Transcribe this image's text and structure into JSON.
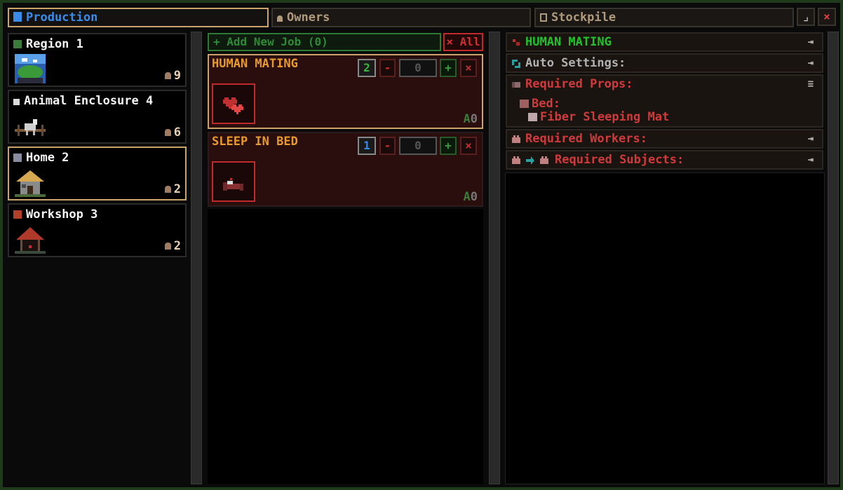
{
  "tabs": {
    "production": "Production",
    "owners": "Owners",
    "stockpile": "Stockpile"
  },
  "window": {
    "minimize_icon": "⌟",
    "close_icon": "×"
  },
  "buildings": [
    {
      "name": "Region 1",
      "count": "9",
      "icon": "region-icon"
    },
    {
      "name": "Animal Enclosure 4",
      "count": "6",
      "icon": "paw-icon"
    },
    {
      "name": "Home 2",
      "count": "2",
      "icon": "house-icon"
    },
    {
      "name": "Workshop 3",
      "count": "2",
      "icon": "workshop-icon"
    }
  ],
  "jobs_header": {
    "add_label": "+ Add New Job (0)",
    "clear_label": "× All"
  },
  "jobs": [
    {
      "title": "HUMAN MATING",
      "priority": "2",
      "minus": "-",
      "quantity": "0",
      "plus": "+",
      "remove": "×",
      "auto_letter": "A",
      "auto_count": "0",
      "priority_color": "#3ab83a"
    },
    {
      "title": "SLEEP IN BED",
      "priority": "1",
      "minus": "-",
      "quantity": "0",
      "plus": "+",
      "remove": "×",
      "auto_letter": "A",
      "auto_count": "0",
      "priority_color": "#3a8be8"
    }
  ],
  "details": {
    "job_title": "HUMAN MATING",
    "auto_settings": "Auto Settings:",
    "required_props": "Required Props:",
    "prop_category": "Bed:",
    "prop_item": "Fiber Sleeping Mat",
    "required_workers": "Required Workers:",
    "required_subjects": "Required Subjects:",
    "collapse_icon": "⇥",
    "list_icon": "≡"
  },
  "colors": {
    "accent_blue": "#3a8be8",
    "accent_green": "#22c12a",
    "warning_red": "#d03a3a",
    "job_title_orange": "#e89a2c",
    "selection_gold": "#c9a36b"
  }
}
